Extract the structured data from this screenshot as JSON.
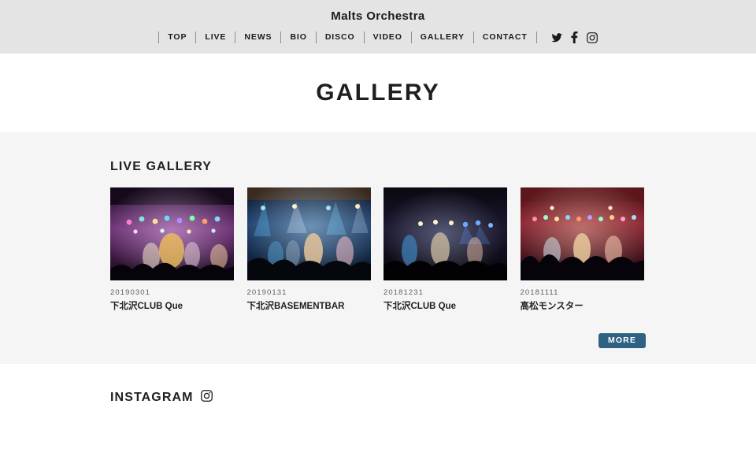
{
  "header": {
    "site_title": "Malts Orchestra",
    "nav_items": [
      {
        "label": "TOP"
      },
      {
        "label": "LIVE"
      },
      {
        "label": "NEWS"
      },
      {
        "label": "BIO"
      },
      {
        "label": "DISCO"
      },
      {
        "label": "VIDEO"
      },
      {
        "label": "GALLERY"
      },
      {
        "label": "CONTACT"
      }
    ],
    "social": [
      {
        "name": "twitter-icon"
      },
      {
        "name": "facebook-icon"
      },
      {
        "name": "instagram-icon"
      }
    ],
    "background_color": "#e4e4e4"
  },
  "page": {
    "title": "GALLERY"
  },
  "gallery": {
    "heading": "LIVE GALLERY",
    "background_color": "#f5f5f5",
    "items": [
      {
        "date": "20190301",
        "venue": "下北沢CLUB Que",
        "thumb_alt": "live-photo-purple-stage"
      },
      {
        "date": "20190131",
        "venue": "下北沢BASEMENTBAR",
        "thumb_alt": "live-photo-blue-stage"
      },
      {
        "date": "20181231",
        "venue": "下北沢CLUB Que",
        "thumb_alt": "live-photo-dark-stage"
      },
      {
        "date": "20181111",
        "venue": "高松モンスター",
        "thumb_alt": "live-photo-red-stage"
      }
    ],
    "more_label": "MORE",
    "more_color": "#2f6183"
  },
  "instagram": {
    "heading": "INSTAGRAM",
    "icon": "instagram-icon"
  }
}
